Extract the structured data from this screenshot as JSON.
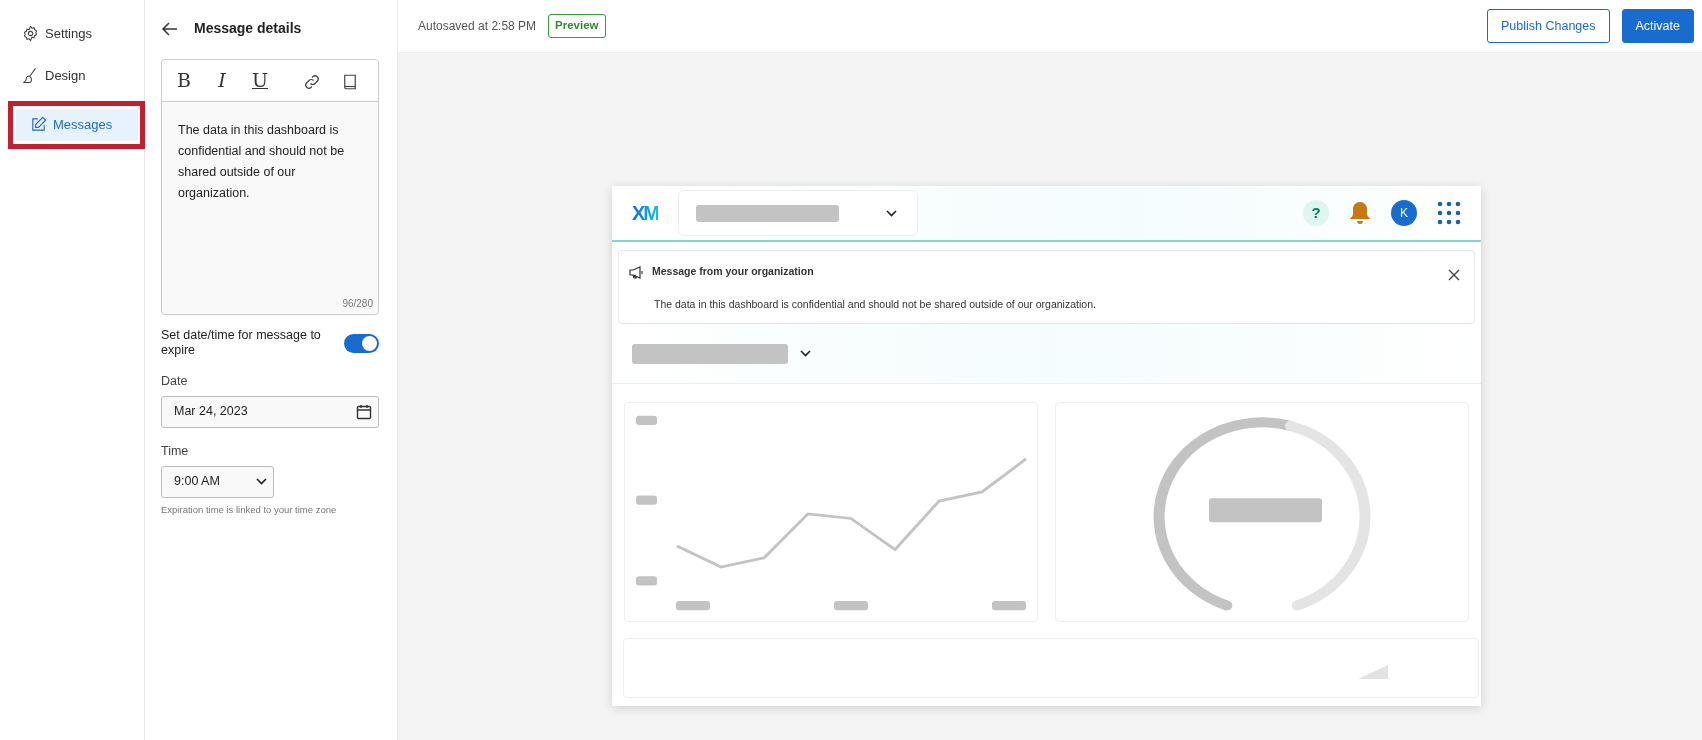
{
  "nav": {
    "items": [
      {
        "label": "Settings",
        "kind": "gear",
        "selected": false,
        "outlined": false
      },
      {
        "label": "Design",
        "kind": "brush",
        "selected": false,
        "outlined": false
      },
      {
        "label": "Messages",
        "kind": "pencil",
        "selected": true,
        "outlined": true
      }
    ]
  },
  "panel": {
    "title": "Message details",
    "toolbar": [
      {
        "kind": "bold",
        "label": "B"
      },
      {
        "kind": "italic",
        "label": "I"
      },
      {
        "kind": "underline",
        "label": "U"
      },
      {
        "kind": "link"
      },
      {
        "kind": "book"
      }
    ],
    "message": "The data in this dashboard is confidential and should not be shared outside of our organization.",
    "counter": "96/280",
    "expire": {
      "label": "Set date/time for message to expire",
      "on": true
    },
    "date": {
      "label": "Date",
      "value": "Mar 24, 2023"
    },
    "time": {
      "label": "Time",
      "value": "9:00 AM",
      "hint": "Expiration time is linked to your time zone"
    }
  },
  "topbar": {
    "autosave": "Autosaved at 2:58 PM",
    "badge": "Preview",
    "buttons": [
      {
        "label": "Publish Changes",
        "kind": "outline"
      },
      {
        "label": "Activate",
        "kind": "primary"
      }
    ]
  },
  "preview": {
    "logo": "XM",
    "help": "?",
    "avatar": "K",
    "banner": {
      "title": "Message from your organization",
      "text": "The data in this dashboard is confidential and should not be shared outside of our organization."
    }
  }
}
